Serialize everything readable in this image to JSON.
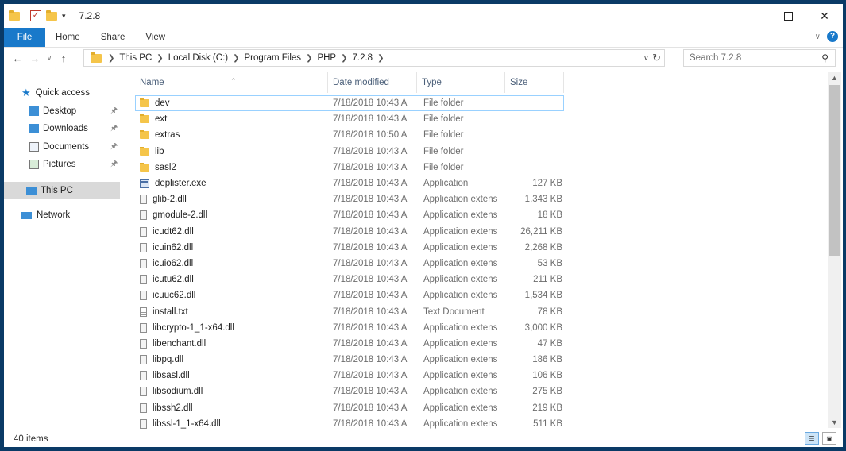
{
  "window": {
    "title": "7.2.8"
  },
  "ribbon": {
    "tabs": [
      "File",
      "Home",
      "Share",
      "View"
    ]
  },
  "address": {
    "crumbs": [
      "This PC",
      "Local Disk (C:)",
      "Program Files",
      "PHP",
      "7.2.8"
    ]
  },
  "search": {
    "placeholder": "Search 7.2.8"
  },
  "nav": {
    "quick_access": "Quick access",
    "items": [
      "Desktop",
      "Downloads",
      "Documents",
      "Pictures"
    ],
    "this_pc": "This PC",
    "network": "Network"
  },
  "columns": {
    "name": "Name",
    "date": "Date modified",
    "type": "Type",
    "size": "Size"
  },
  "files": [
    {
      "name": "dev",
      "date": "7/18/2018 10:43 A",
      "type": "File folder",
      "size": "",
      "icon": "folder-icon"
    },
    {
      "name": "ext",
      "date": "7/18/2018 10:43 A",
      "type": "File folder",
      "size": "",
      "icon": "folder-icon"
    },
    {
      "name": "extras",
      "date": "7/18/2018 10:50 A",
      "type": "File folder",
      "size": "",
      "icon": "folder-icon"
    },
    {
      "name": "lib",
      "date": "7/18/2018 10:43 A",
      "type": "File folder",
      "size": "",
      "icon": "folder-icon"
    },
    {
      "name": "sasl2",
      "date": "7/18/2018 10:43 A",
      "type": "File folder",
      "size": "",
      "icon": "folder-icon"
    },
    {
      "name": "deplister.exe",
      "date": "7/18/2018 10:43 A",
      "type": "Application",
      "size": "127 KB",
      "icon": "exe-icon"
    },
    {
      "name": "glib-2.dll",
      "date": "7/18/2018 10:43 A",
      "type": "Application extens",
      "size": "1,343 KB",
      "icon": "dll-icon"
    },
    {
      "name": "gmodule-2.dll",
      "date": "7/18/2018 10:43 A",
      "type": "Application extens",
      "size": "18 KB",
      "icon": "dll-icon"
    },
    {
      "name": "icudt62.dll",
      "date": "7/18/2018 10:43 A",
      "type": "Application extens",
      "size": "26,211 KB",
      "icon": "dll-icon"
    },
    {
      "name": "icuin62.dll",
      "date": "7/18/2018 10:43 A",
      "type": "Application extens",
      "size": "2,268 KB",
      "icon": "dll-icon"
    },
    {
      "name": "icuio62.dll",
      "date": "7/18/2018 10:43 A",
      "type": "Application extens",
      "size": "53 KB",
      "icon": "dll-icon"
    },
    {
      "name": "icutu62.dll",
      "date": "7/18/2018 10:43 A",
      "type": "Application extens",
      "size": "211 KB",
      "icon": "dll-icon"
    },
    {
      "name": "icuuc62.dll",
      "date": "7/18/2018 10:43 A",
      "type": "Application extens",
      "size": "1,534 KB",
      "icon": "dll-icon"
    },
    {
      "name": "install.txt",
      "date": "7/18/2018 10:43 A",
      "type": "Text Document",
      "size": "78 KB",
      "icon": "text-file-icon"
    },
    {
      "name": "libcrypto-1_1-x64.dll",
      "date": "7/18/2018 10:43 A",
      "type": "Application extens",
      "size": "3,000 KB",
      "icon": "dll-icon"
    },
    {
      "name": "libenchant.dll",
      "date": "7/18/2018 10:43 A",
      "type": "Application extens",
      "size": "47 KB",
      "icon": "dll-icon"
    },
    {
      "name": "libpq.dll",
      "date": "7/18/2018 10:43 A",
      "type": "Application extens",
      "size": "186 KB",
      "icon": "dll-icon"
    },
    {
      "name": "libsasl.dll",
      "date": "7/18/2018 10:43 A",
      "type": "Application extens",
      "size": "106 KB",
      "icon": "dll-icon"
    },
    {
      "name": "libsodium.dll",
      "date": "7/18/2018 10:43 A",
      "type": "Application extens",
      "size": "275 KB",
      "icon": "dll-icon"
    },
    {
      "name": "libssh2.dll",
      "date": "7/18/2018 10:43 A",
      "type": "Application extens",
      "size": "219 KB",
      "icon": "dll-icon"
    },
    {
      "name": "libssl-1_1-x64.dll",
      "date": "7/18/2018 10:43 A",
      "type": "Application extens",
      "size": "511 KB",
      "icon": "dll-icon"
    }
  ],
  "status": {
    "items": "40 items"
  },
  "colors": {
    "accent": "#1979ca",
    "folder": "#f5c54a",
    "selected": "#d9d9d9",
    "header_text": "#4c607a"
  }
}
